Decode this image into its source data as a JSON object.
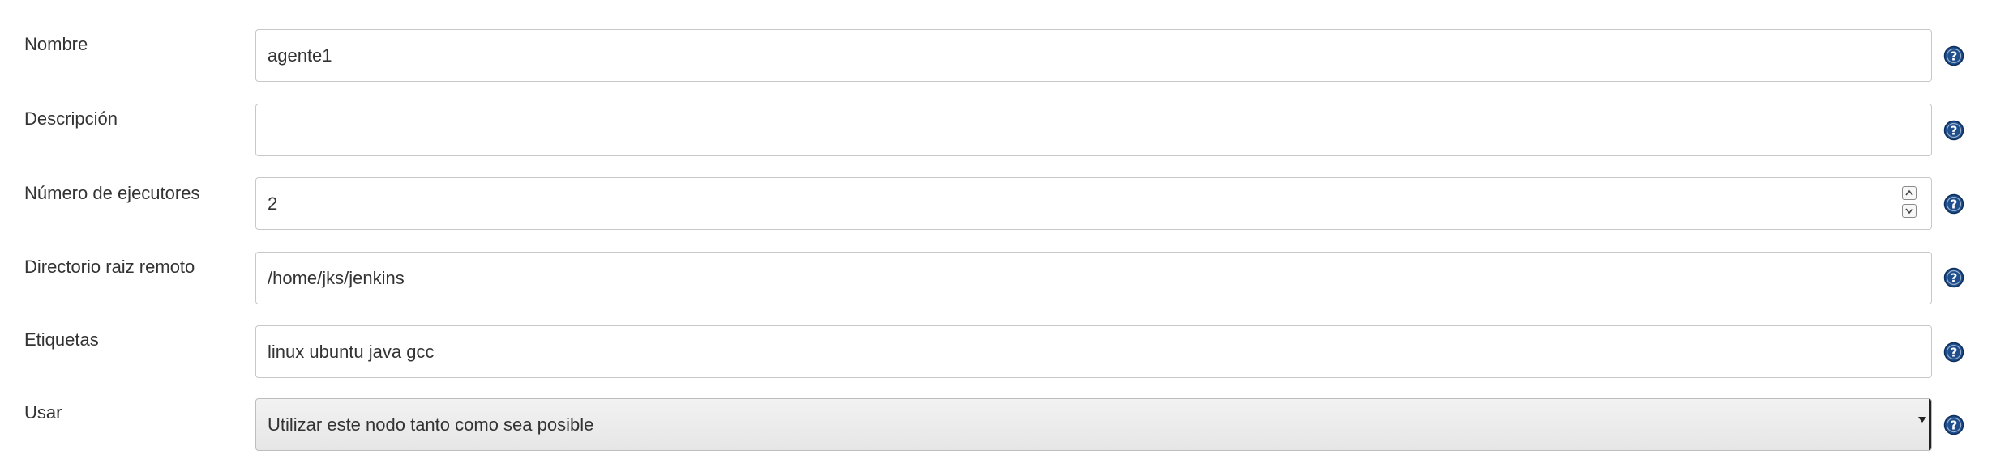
{
  "form": {
    "fields": [
      {
        "label": "Nombre",
        "value": "agente1",
        "type": "text"
      },
      {
        "label": "Descripción",
        "value": "",
        "type": "text"
      },
      {
        "label": "Número de ejecutores",
        "value": "2",
        "type": "number"
      },
      {
        "label": "Directorio raiz remoto",
        "value": "/home/jks/jenkins",
        "type": "text"
      },
      {
        "label": "Etiquetas",
        "value": "linux ubuntu java gcc",
        "type": "text"
      },
      {
        "label": "Usar",
        "value": "Utilizar este nodo tanto como sea posible",
        "type": "select"
      }
    ],
    "help_icon": "help-question-icon"
  },
  "colors": {
    "label_text": "#333333",
    "input_border": "#c8c8c8",
    "select_background": "#eeeeee",
    "help_icon_fill": "#1f4e8c"
  }
}
